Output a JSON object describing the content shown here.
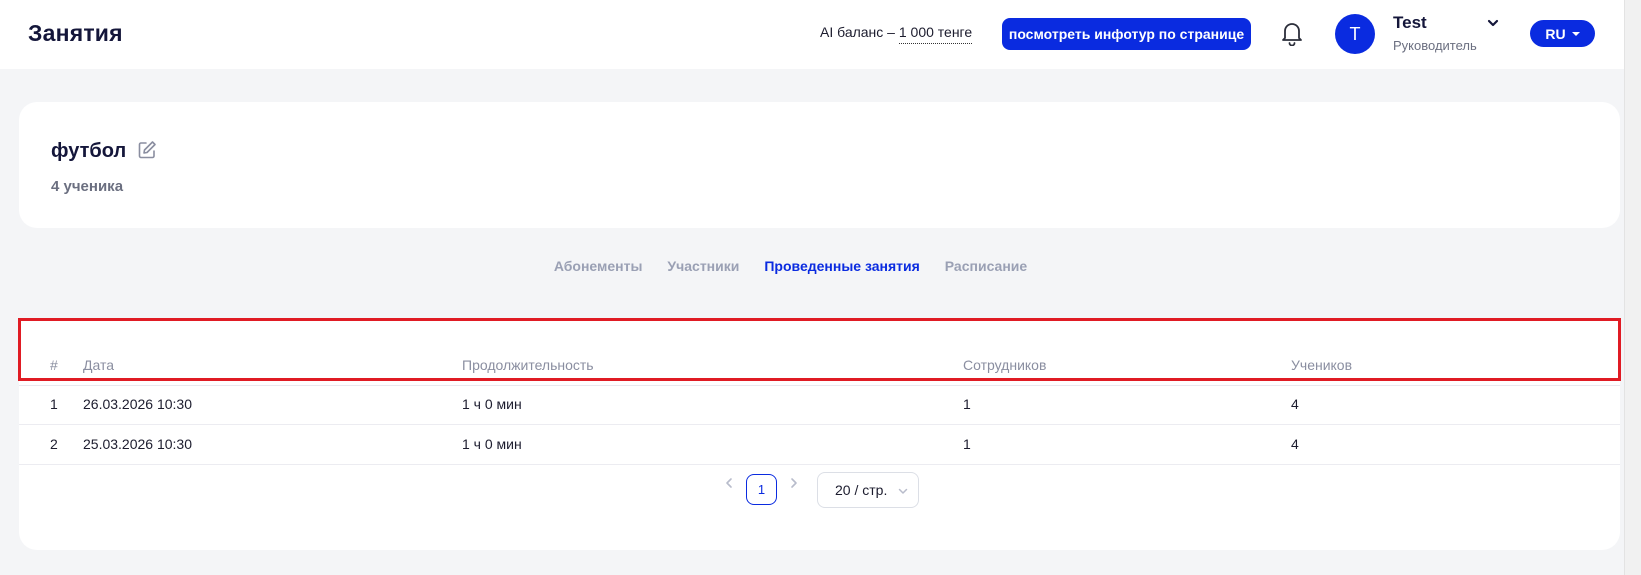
{
  "header": {
    "title": "Занятия",
    "balance_label": "AI баланс – ",
    "balance_amount": "1 000 тенге",
    "tour_button": "посмотреть инфотур по странице",
    "user": {
      "avatar_letter": "T",
      "name": "Test",
      "role": "Руководитель"
    },
    "language": "RU"
  },
  "course": {
    "name": "футбол",
    "students": "4 ученика"
  },
  "tabs": [
    {
      "label": "Абонементы",
      "active": false
    },
    {
      "label": "Участники",
      "active": false
    },
    {
      "label": "Проведенные занятия",
      "active": true
    },
    {
      "label": "Расписание",
      "active": false
    }
  ],
  "table": {
    "columns": [
      "#",
      "Дата",
      "Продолжительность",
      "Сотрудников",
      "Учеников"
    ],
    "rows": [
      [
        "1",
        "26.03.2026 10:30",
        "1 ч 0 мин",
        "1",
        "4"
      ],
      [
        "2",
        "25.03.2026 10:30",
        "1 ч 0 мин",
        "1",
        "4"
      ]
    ]
  },
  "pagination": {
    "current_page": "1",
    "page_size": "20 / стр."
  },
  "colors": {
    "accent": "#0a2be0",
    "highlight": "#e01b24"
  }
}
